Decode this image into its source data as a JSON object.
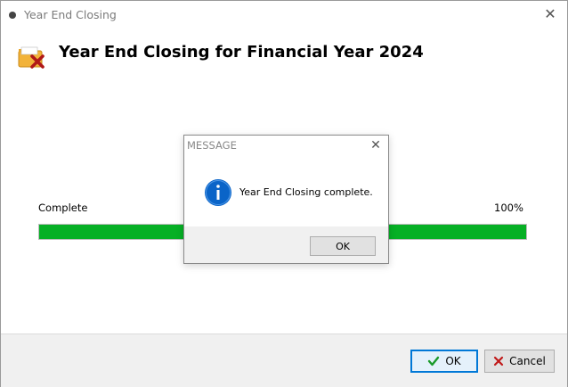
{
  "window": {
    "title": "Year End Closing",
    "close_glyph": "✕"
  },
  "header": {
    "title": "Year End Closing for Financial Year 2024",
    "icon": "folder-close-icon"
  },
  "progress": {
    "label": "Complete",
    "percent_text": "100%",
    "value": 100,
    "color": "#06b025"
  },
  "footer": {
    "ok_label": "OK",
    "cancel_label": "Cancel",
    "ok_icon": "checkmark-icon",
    "cancel_icon": "x-icon",
    "ok_icon_color": "#1a9a2a",
    "cancel_icon_color": "#c01818"
  },
  "modal": {
    "title": "MESSAGE",
    "close_glyph": "✕",
    "message": "Year End Closing complete.",
    "ok_label": "OK",
    "icon": "info-icon",
    "icon_color": "#0a64c8"
  }
}
